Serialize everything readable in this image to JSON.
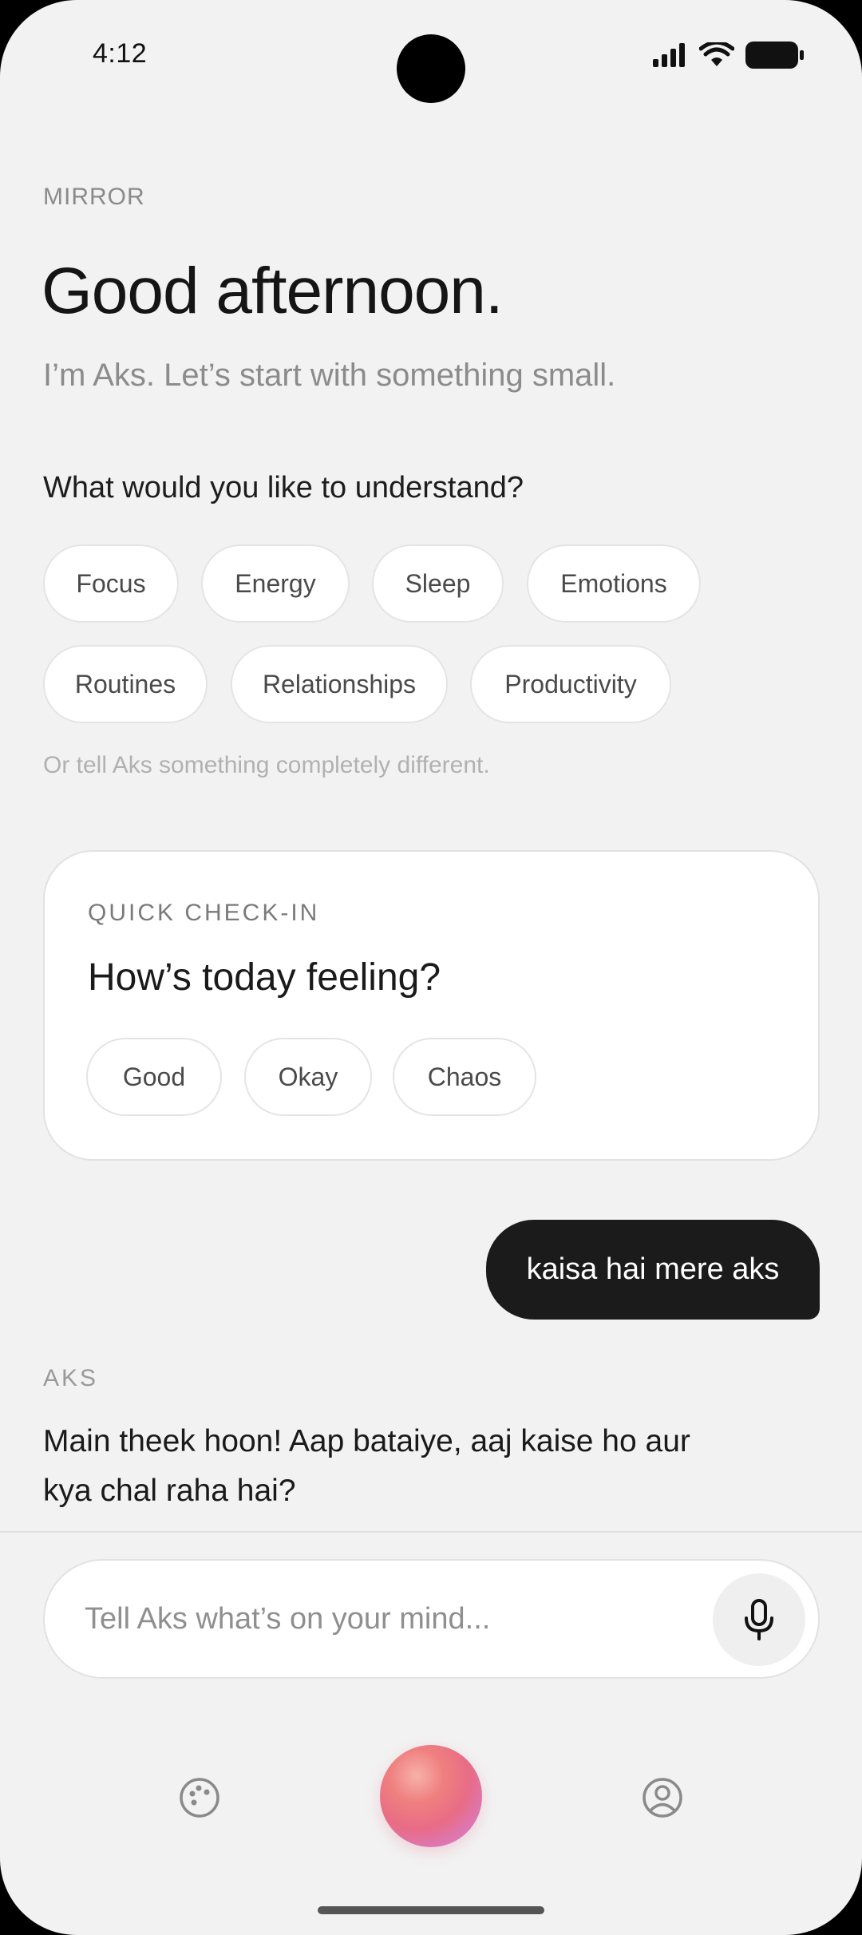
{
  "status": {
    "time": "4:12"
  },
  "header": {
    "eyebrow": "MIRROR",
    "greeting": "Good afternoon.",
    "subtitle": "I’m Aks. Let’s start with something small."
  },
  "topics": {
    "question": "What would you like to understand?",
    "chips": [
      "Focus",
      "Energy",
      "Sleep",
      "Emotions",
      "Routines",
      "Relationships",
      "Productivity"
    ],
    "hint": "Or tell Aks something completely different."
  },
  "checkin": {
    "eyebrow": "QUICK CHECK-IN",
    "title": "How’s today feeling?",
    "options": [
      "Good",
      "Okay",
      "Chaos"
    ]
  },
  "chat": {
    "user_message": "kaisa hai mere aks",
    "assistant_label": "AKS",
    "assistant_message": "Main theek hoon! Aap bataiye, aaj kaise ho aur kya chal raha hai?"
  },
  "composer": {
    "placeholder": "Tell Aks what’s on your mind...",
    "mic_icon": "microphone-icon"
  },
  "nav": {
    "left_icon": "palette-icon",
    "center_icon": "aks-orb",
    "right_icon": "profile-icon"
  },
  "colors": {
    "background": "#f2f2f2",
    "user_bubble": "#1b1b1b",
    "orb_primary": "#e86c86"
  }
}
